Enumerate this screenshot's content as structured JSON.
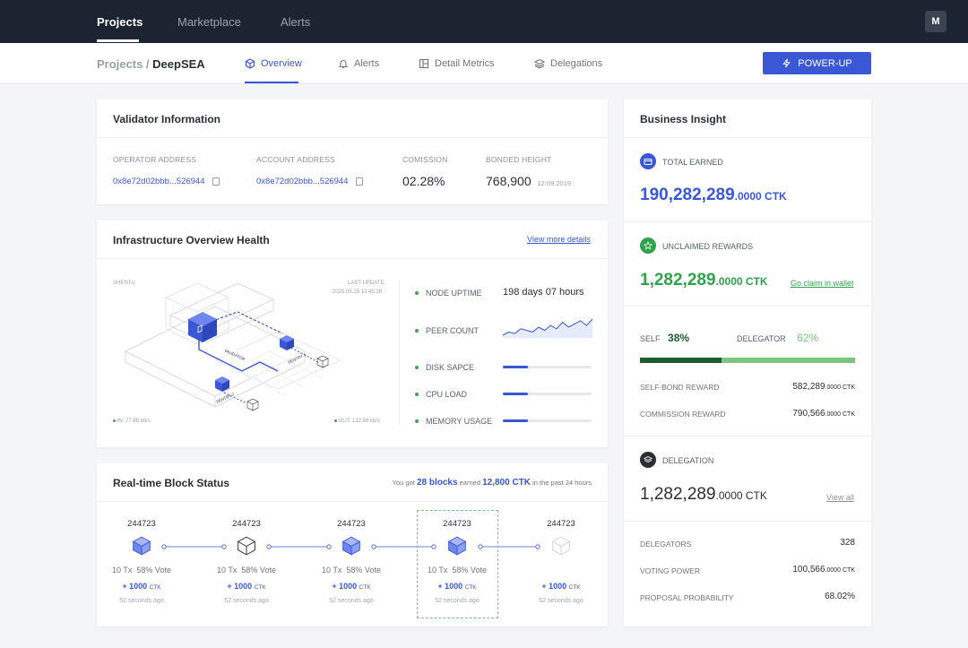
{
  "topnav": {
    "items": [
      "Projects",
      "Marketplace",
      "Alerts"
    ],
    "avatar": "M"
  },
  "subnav": {
    "breadcrumb_parent": "Projects /",
    "breadcrumb_current": "DeepSEA",
    "tabs": [
      "Overview",
      "Alerts",
      "Detail Metrics",
      "Delegations"
    ],
    "powerup": "POWER-UP"
  },
  "validator": {
    "title": "Validator Information",
    "operator_label": "OPERATOR ADDRESS",
    "operator_value": "0x8e72d02bbb...526944",
    "account_label": "ACCOUNT ADDRESS",
    "account_value": "0x8e72d02bbb...526944",
    "commission_label": "COMISSION",
    "commission_value": "02.28%",
    "bonded_label": "BONDED HEIGHT",
    "bonded_value": "768,900",
    "bonded_date": "12.09.2019"
  },
  "infra": {
    "title": "Infrastructure Overview Health",
    "view_more": "View more details",
    "shentu": "SHENTU",
    "last_update_label": "LAST UPDATE",
    "last_update_value": "2020.05.15 13:45:38",
    "in_rate": "IN: 77.88 kb/s",
    "out_rate": "OUT: 122.88 kb/s",
    "node_labels": [
      "VALIDATOR",
      "SENTRY 1",
      "SENTRY 2"
    ],
    "metrics": {
      "uptime_label": "NODE UPTIME",
      "uptime_value": "198 days 07 hours",
      "peer_label": "PEER COUNT",
      "peer_series": [
        4,
        6,
        5,
        8,
        7,
        6,
        9,
        7,
        10,
        8,
        12,
        9,
        11,
        13,
        10,
        14
      ],
      "disk_label": "DISK SAPCE",
      "disk_fill": 0.28,
      "cpu_label": "CPU LOAD",
      "cpu_fill": 0.28,
      "memory_label": "MEMORY USAGE",
      "memory_fill": 0.28
    }
  },
  "blocks": {
    "title": "Real-time Block Status",
    "summary_pre": "You got",
    "summary_blocks": "28 blocks",
    "summary_mid": "earned",
    "summary_ctk": "12,800 CTK",
    "summary_post": "in the past 24 hours",
    "items": [
      {
        "num": "244723",
        "tx": "10 Tx",
        "vote": "58% Vote",
        "reward": "+ 1000",
        "unit": "CTK",
        "ago": "52 seconds ago",
        "style": "blue"
      },
      {
        "num": "244723",
        "tx": "10 Tx",
        "vote": "58% Vote",
        "reward": "+ 1000",
        "unit": "CTK",
        "ago": "52 seconds ago",
        "style": "outline"
      },
      {
        "num": "244723",
        "tx": "10 Tx",
        "vote": "58% Vote",
        "reward": "+ 1000",
        "unit": "CTK",
        "ago": "52 seconds ago",
        "style": "blue"
      },
      {
        "num": "244723",
        "tx": "10 Tx",
        "vote": "58% Vote",
        "reward": "+ 1000",
        "unit": "CTK",
        "ago": "52 seconds ago",
        "style": "blue"
      },
      {
        "num": "244723",
        "tx": "",
        "vote": "",
        "reward": "+ 1000",
        "unit": "CTK",
        "ago": "52 seconds ago",
        "style": "faded"
      }
    ]
  },
  "insight": {
    "title": "Business Insight",
    "total_label": "TOTAL EARNED",
    "total_int": "190,282,289",
    "total_dec": ".0000 CTK",
    "unclaimed_label": "UNCLAIMED REWARDS",
    "unclaimed_int": "1,282,289",
    "unclaimed_dec": ".0000 CTK",
    "claim_link": "Go claim in wallet",
    "self_label": "SELF",
    "self_pct": "38%",
    "self_fraction": 0.38,
    "delegator_label": "DELEGATOR",
    "delegator_pct": "62%",
    "selfbond_label": "SELF-BOND REWARD",
    "selfbond_value": "582,289",
    "selfbond_dec": ".0000 CTK",
    "commission_label": "COMMISSION REWARD",
    "commission_value": "790,566",
    "commission_dec": ".0000 CTK",
    "delegation_label": "DELEGATION",
    "delegation_int": "1,282,289",
    "delegation_dec": ".0000 CTK",
    "view_all": "View all",
    "delegators_label": "DELEGATORS",
    "delegators_value": "328",
    "voting_label": "VOTING POWER",
    "voting_value": "100,566",
    "voting_dec": ".0000 CTK",
    "proposal_label": "PROPOSAL PROBABILITY",
    "proposal_value": "68.02%"
  },
  "colors": {
    "accent": "#3a57d6",
    "green": "#2ea34a",
    "dark_green": "#1e5e2e",
    "light_green": "#7cc47f",
    "nav_bg": "#1b2430"
  }
}
